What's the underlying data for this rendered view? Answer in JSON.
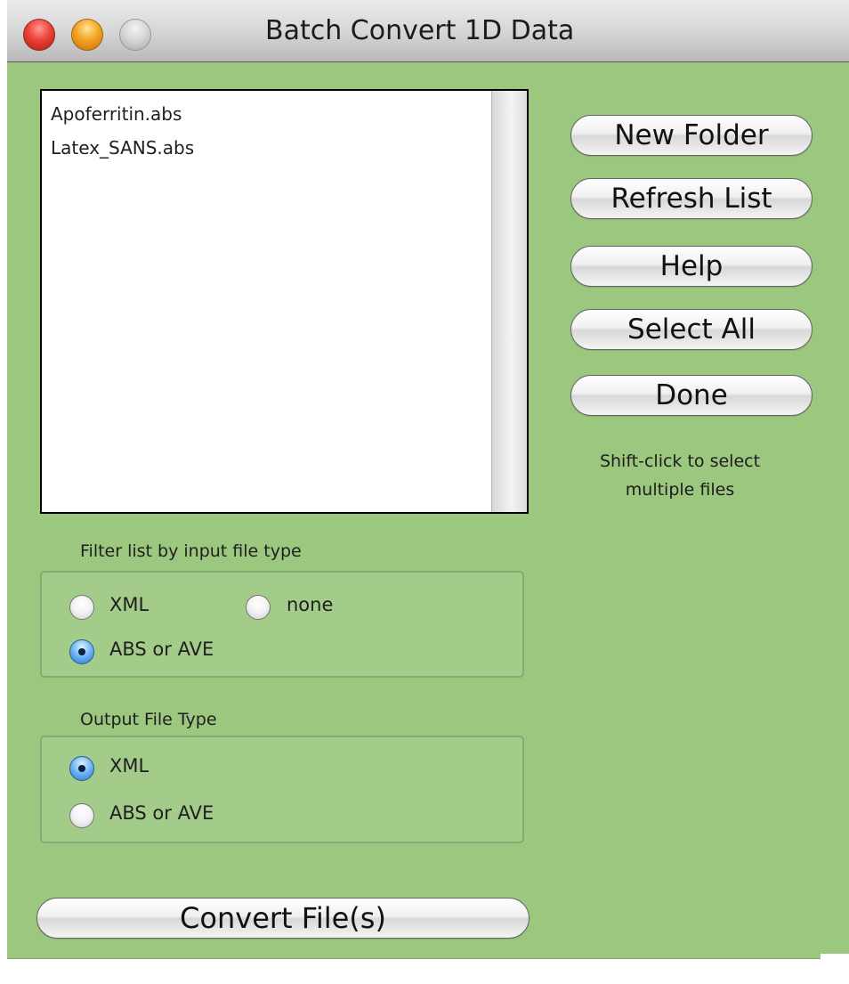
{
  "window": {
    "title": "Batch Convert 1D Data"
  },
  "file_list": {
    "items": [
      "Apoferritin.abs",
      "Latex_SANS.abs"
    ]
  },
  "buttons": {
    "new_folder": "New Folder",
    "refresh_list": "Refresh List",
    "help": "Help",
    "select_all": "Select All",
    "done": "Done",
    "convert": "Convert File(s)"
  },
  "hint": "Shift-click to select multiple files",
  "filter_group": {
    "label": "Filter list by input file type",
    "options": [
      {
        "label": "XML",
        "selected": false
      },
      {
        "label": "none",
        "selected": false
      },
      {
        "label": "ABS or AVE",
        "selected": true
      }
    ]
  },
  "output_group": {
    "label": "Output File Type",
    "options": [
      {
        "label": "XML",
        "selected": true
      },
      {
        "label": "ABS or AVE",
        "selected": false
      }
    ]
  },
  "colors": {
    "window_background": "#9cc77f",
    "selected_radio": "#2f78c6"
  }
}
